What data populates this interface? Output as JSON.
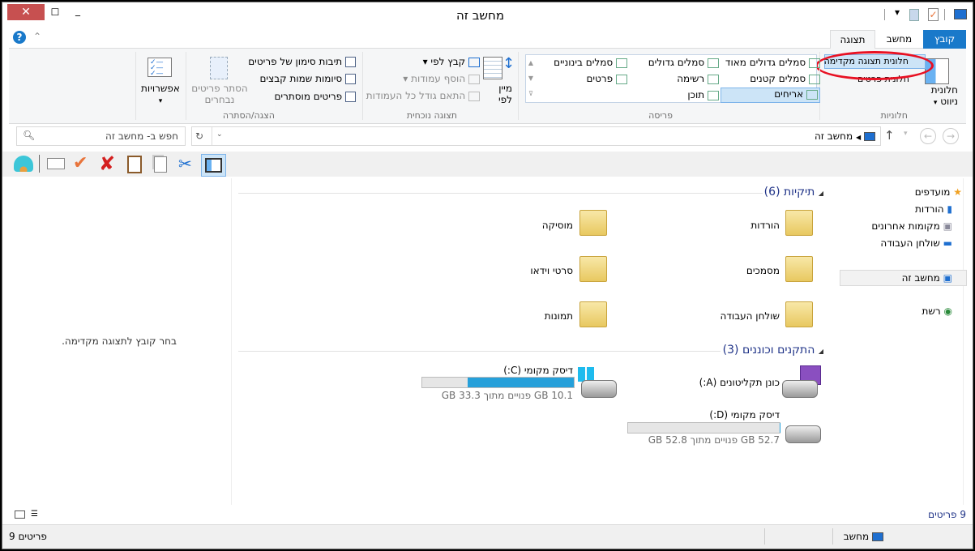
{
  "window": {
    "title": "מחשב זה",
    "close": "✕",
    "maximize": "☐",
    "minimize": "_"
  },
  "quick_access": {
    "dropdown": "▾"
  },
  "tabs": [
    {
      "label": "קובץ"
    },
    {
      "label": "מחשב"
    },
    {
      "label": "תצוגה"
    }
  ],
  "help": "?",
  "ribbon": {
    "panes": {
      "group": "חלוניות",
      "nav_pane": "חלונית ניווט",
      "nav_arrow": "▾",
      "preview_pane": "חלונית תצוגה מקדימה",
      "details_pane": "חלונית פרטים"
    },
    "layout": {
      "group": "פריסה",
      "items": [
        "סמלים גדולים מאוד",
        "סמלים גדולים",
        "סמלים בינוניים",
        "סמלים קטנים",
        "רשימה",
        "פרטים",
        "אריחים",
        "תוכן"
      ]
    },
    "current_view": {
      "group": "תצוגה נוכחית",
      "sort_by": "מיין לפי",
      "group_by": "קבץ לפי",
      "add_columns": "הוסף עמודות",
      "size_columns": "התאם גודל כל העמודות"
    },
    "show_hide": {
      "group": "הצגה/הסתרה",
      "item_checkboxes": "תיבות סימון של פריטים",
      "file_extensions": "סיומות שמות קבצים",
      "hidden_items": "פריטים מוסתרים",
      "hide_selected": "הסתר פריטים נבחרים"
    },
    "options": {
      "label": "אפשרויות"
    }
  },
  "address": {
    "path": "מחשב זה",
    "search_placeholder": "חפש ב- מחשב זה"
  },
  "nav_pane": {
    "favorites": "מועדפים",
    "items": [
      "הורדות",
      "מקומות אחרונים",
      "שולחן העבודה"
    ],
    "this_pc": "מחשב זה",
    "network": "רשת"
  },
  "content": {
    "folders_header": "תיקיות (6)",
    "folders": [
      "הורדות",
      "מוסיקה",
      "מסמכים",
      "סרטי וידאו",
      "שולחן העבודה",
      "תמונות"
    ],
    "drives_header": "התקנים וכוננים (3)",
    "drives": [
      {
        "name": "כונן תקליטונים (A:)"
      },
      {
        "name": "דיסק מקומי (C:)",
        "space": "10.1 GB פנויים מתוך 33.3 GB",
        "used_fraction": 0.7
      },
      {
        "name": "דיסק מקומי (D:)",
        "space": "52.7 GB פנויים מתוך 52.8 GB",
        "used_fraction": 0.002
      }
    ]
  },
  "preview": {
    "message": "בחר קובץ לתצוגה מקדימה."
  },
  "status": {
    "count": "9 פריטים",
    "bottom_left": "פריטים 9",
    "bottom_right": "מחשב"
  },
  "colors": {
    "accent": "#1979ca",
    "close": "#c75050",
    "bar": "#26a0da",
    "highlight": "#e81123"
  }
}
